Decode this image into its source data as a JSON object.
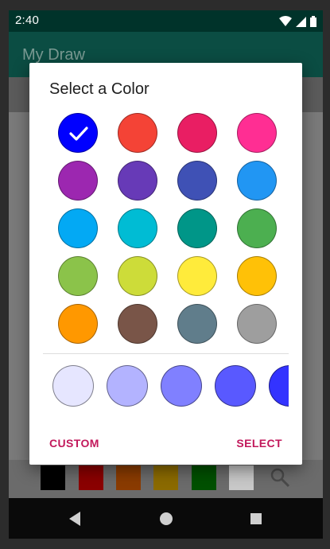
{
  "statusbar": {
    "time": "2:40"
  },
  "app": {
    "title": "My Draw"
  },
  "dialog": {
    "title": "Select a Color",
    "selected_index": 0,
    "colors": [
      "#0000ff",
      "#f44336",
      "#e91e63",
      "#ff2e93",
      "#9c27b0",
      "#673ab7",
      "#3f51b5",
      "#2196f3",
      "#03a9f4",
      "#00bcd4",
      "#009688",
      "#4caf50",
      "#8bc34a",
      "#cddc39",
      "#ffeb3b",
      "#ffc107",
      "#ff9800",
      "#795548",
      "#607d8b",
      "#9e9e9e"
    ],
    "shades": [
      "#e6e6ff",
      "#b3b3ff",
      "#8080ff",
      "#5959ff",
      "#3333ff"
    ],
    "custom_label": "CUSTOM",
    "select_label": "SELECT"
  },
  "palette_bar": {
    "colors": [
      "#000000",
      "#8b0000",
      "#8a3b00",
      "#8b6a00",
      "#005000",
      "#c8c8c8"
    ]
  },
  "icons": {
    "wifi": "wifi-icon",
    "signal": "signal-icon",
    "battery": "battery-icon",
    "search": "search-icon",
    "back": "back-icon",
    "home": "home-icon",
    "recents": "recents-icon"
  }
}
